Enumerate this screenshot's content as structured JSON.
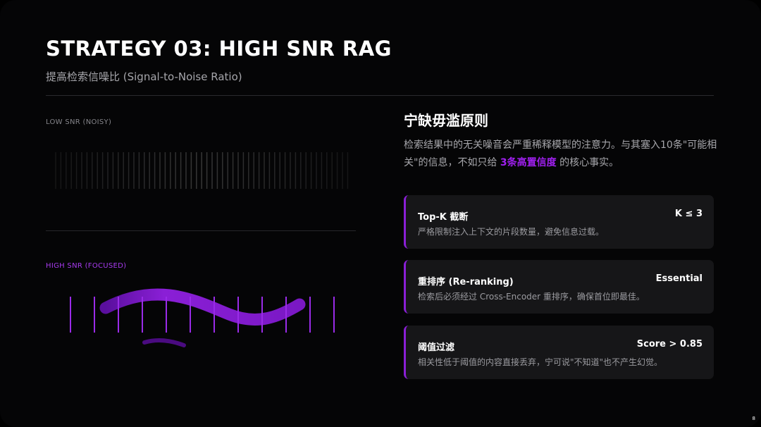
{
  "slide": {
    "title": "STRATEGY 03: HIGH SNR RAG",
    "subtitle": "提高检索信噪比 (Signal-to-Noise Ratio)",
    "page_number": "8"
  },
  "left": {
    "low_label": "LOW SNR (NOISY)",
    "high_label": "HIGH SNR (FOCUSED)"
  },
  "right": {
    "heading": "宁缺毋滥原则",
    "desc_before": "检索结果中的无关噪音会严重稀释模型的注意力。与其塞入10条\"可能相关\"的信息，不如只给 ",
    "desc_highlight": "3条高置信度",
    "desc_after": " 的核心事实。",
    "cards": [
      {
        "name": "Top-K 截断",
        "value": "K ≤ 3",
        "desc": "严格限制注入上下文的片段数量，避免信息过载。"
      },
      {
        "name": "重排序 (Re-ranking)",
        "value": "Essential",
        "desc": "检索后必须经过 Cross-Encoder 重排序，确保首位即最佳。"
      },
      {
        "name": "阈值过滤",
        "value": "Score > 0.85",
        "desc": "相关性低于阈值的内容直接丢弃，宁可说\"不知道\"也不产生幻觉。"
      }
    ]
  },
  "colors": {
    "background": "#050506",
    "accent": "#8a1fd6",
    "highlight": "#a020f0",
    "card": "#161618"
  }
}
